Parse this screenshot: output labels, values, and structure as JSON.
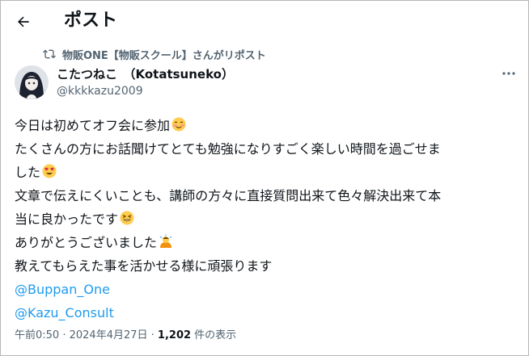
{
  "header": {
    "title": "ポスト",
    "back_icon": "arrow-left-icon"
  },
  "repost": {
    "icon": "repost-icon",
    "text": "物販ONE【物販スクール】さんがリポスト"
  },
  "author": {
    "name": "こたつねこ　（Kotatsuneko）",
    "handle": "@kkkkazu2009"
  },
  "post": {
    "lines": [
      "今日は初めてオフ会に参加",
      "たくさんの方にお話聞けてとても勉強になりすごく楽しい時間を過ごせま",
      "した",
      "文章で伝えにくいことも、講師の方々に直接質問出来て色々解決出来て本",
      "当に良かったです",
      "ありがとうございました",
      "教えてもらえた事を活かせる様に頑張ります"
    ],
    "emojis": [
      "smiling-blush-emoji",
      "heart-eyes-emoji",
      "grinning-squint-emoji",
      "bowing-person-emoji"
    ],
    "mentions": [
      "@Buppan_One",
      "@Kazu_Consult"
    ]
  },
  "meta": {
    "time": "午前0:50",
    "sep1": " · ",
    "date": "2024年4月27日",
    "sep2": " · ",
    "views": "1,202",
    "views_label": " 件の表示"
  },
  "colors": {
    "accent": "#1d9bf0",
    "secondary_text": "#536471",
    "primary_text": "#0f1419"
  }
}
